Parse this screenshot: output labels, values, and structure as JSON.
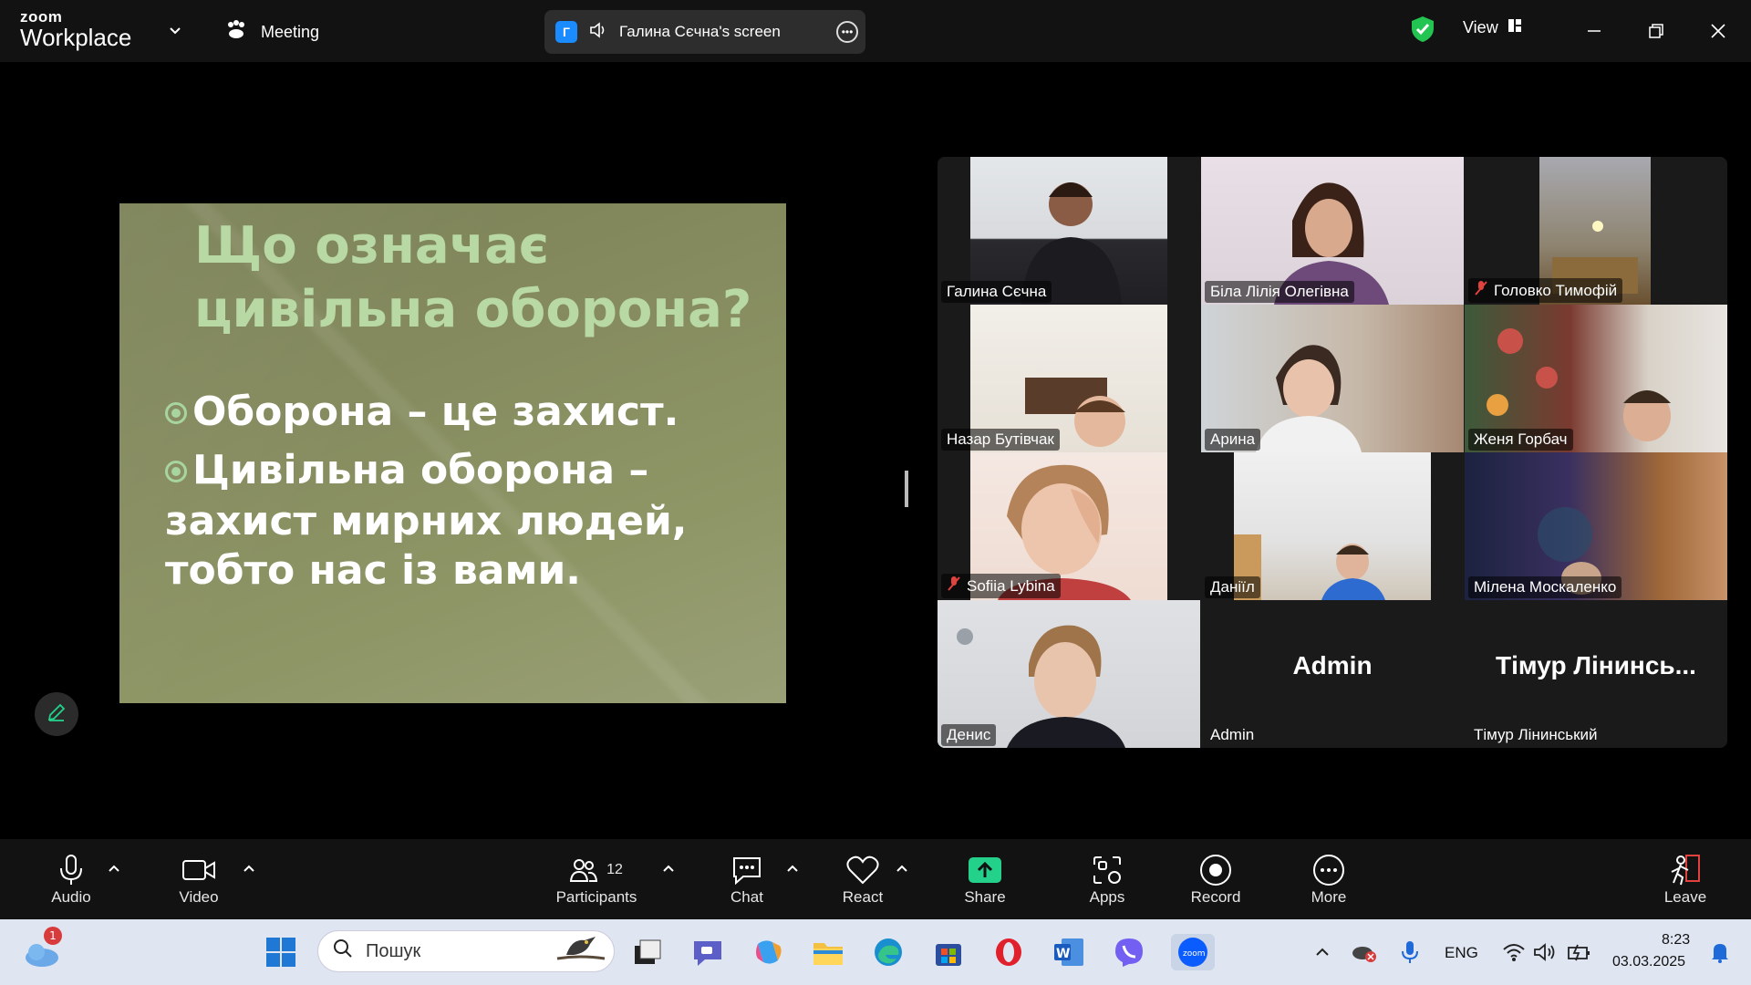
{
  "app": {
    "brand_small": "zoom",
    "brand_large": "Workplace",
    "meeting_label": "Meeting",
    "screen_share_label": "Галина Сєчна's screen",
    "screen_share_badge": "Г",
    "view_label": "View"
  },
  "slide": {
    "title_line1": "Що означає",
    "title_line2": "цивільна оборона?",
    "bullet1": "Оборона – це захист.",
    "bullet2_line1": "Цивільна оборона –",
    "bullet2_line2": "захист мирних людей,",
    "bullet2_line3": "тобто нас із вами."
  },
  "participants": [
    {
      "name": "Галина Сєчна",
      "muted": false,
      "video": true
    },
    {
      "name": "Біла Лілія Олегівна",
      "muted": false,
      "video": true
    },
    {
      "name": "Головко Тимофій",
      "muted": true,
      "video": true
    },
    {
      "name": "Назар Бутівчак",
      "muted": false,
      "video": true
    },
    {
      "name": "Арина",
      "muted": false,
      "video": true
    },
    {
      "name": "Женя Горбач",
      "muted": false,
      "video": true
    },
    {
      "name": "Sofiia Lybina",
      "muted": true,
      "video": true
    },
    {
      "name": "Даніїл",
      "muted": false,
      "video": true
    },
    {
      "name": "Мілена Москаленко",
      "muted": false,
      "video": true
    },
    {
      "name": "Денис",
      "muted": false,
      "video": true,
      "active_speaker": true
    },
    {
      "name": "Admin",
      "big_label": "Admin",
      "video": false
    },
    {
      "name": "Тімур Лінинський",
      "big_label": "Тімур Лінинсь...",
      "video": false
    }
  ],
  "toolbar": {
    "audio": "Audio",
    "video": "Video",
    "participants": "Participants",
    "participants_count": "12",
    "chat": "Chat",
    "react": "React",
    "share": "Share",
    "apps": "Apps",
    "record": "Record",
    "more": "More",
    "leave": "Leave",
    "share_color": "#23d18b"
  },
  "taskbar": {
    "search_placeholder": "Пошук",
    "weather_badge": "1",
    "lang": "ENG",
    "time": "8:23",
    "date": "03.03.2025"
  }
}
